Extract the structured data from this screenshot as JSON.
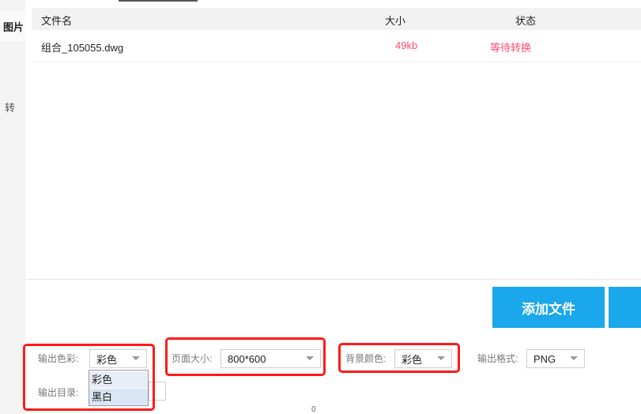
{
  "sidebar": {
    "items": [
      {
        "label": "图片"
      },
      {
        "label": "转"
      }
    ]
  },
  "file_table": {
    "columns": [
      "文件名",
      "大小",
      "状态"
    ],
    "rows": [
      {
        "name": "组合_105055.dwg",
        "size": "49kb",
        "status": "等待转换"
      }
    ]
  },
  "actions": {
    "add_file_label": "添加文件"
  },
  "options": {
    "output_color": {
      "label": "输出色彩:",
      "value": "彩色",
      "dropdown_items": [
        "彩色",
        "黑白"
      ]
    },
    "page_size": {
      "label": "页面大小:",
      "value": "800*600"
    },
    "background_color": {
      "label": "背景颜色:",
      "value": "彩色"
    },
    "output_format": {
      "label": "输出格式:",
      "value": "PNG"
    },
    "output_dir": {
      "label": "输出目录:"
    }
  },
  "misc": {
    "bottom_mark": "0"
  },
  "colors": {
    "accent": "#1aa7ec",
    "status_text": "#ff4b6e",
    "highlight_box": "#ff1a1a"
  }
}
